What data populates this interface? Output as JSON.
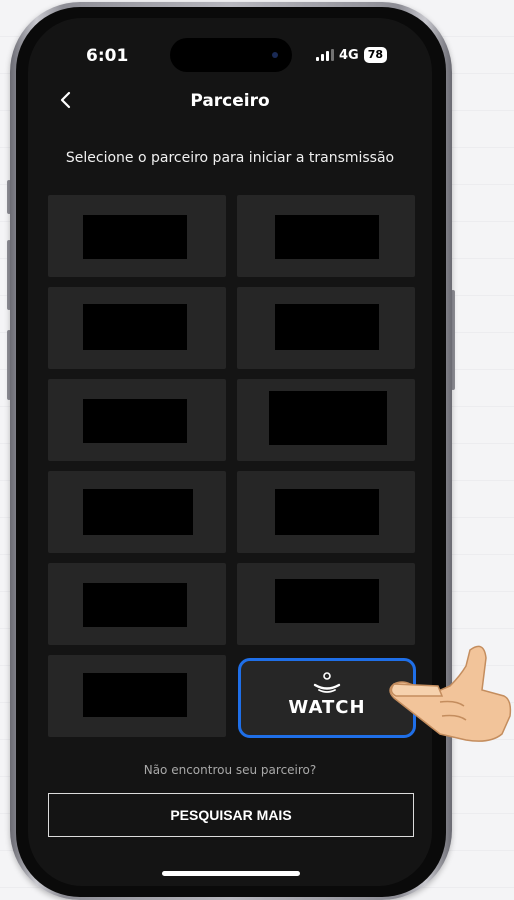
{
  "status_bar": {
    "time": "6:01",
    "network": "4G",
    "battery": "78"
  },
  "header": {
    "title": "Parceiro",
    "back_icon": "chevron-left-icon"
  },
  "subtitle": "Selecione o parceiro para iniciar a transmissão",
  "partners": {
    "tile_count": 12,
    "highlighted_partner": {
      "logo_text": "WATCH",
      "border_color": "#1f6fe8"
    }
  },
  "footer": {
    "help_text": "Não encontrou seu parceiro?",
    "search_button_label": "PESQUISAR MAIS"
  },
  "colors": {
    "screen_bg": "#141414",
    "tile_bg": "#262626",
    "accent": "#1f6fe8"
  }
}
